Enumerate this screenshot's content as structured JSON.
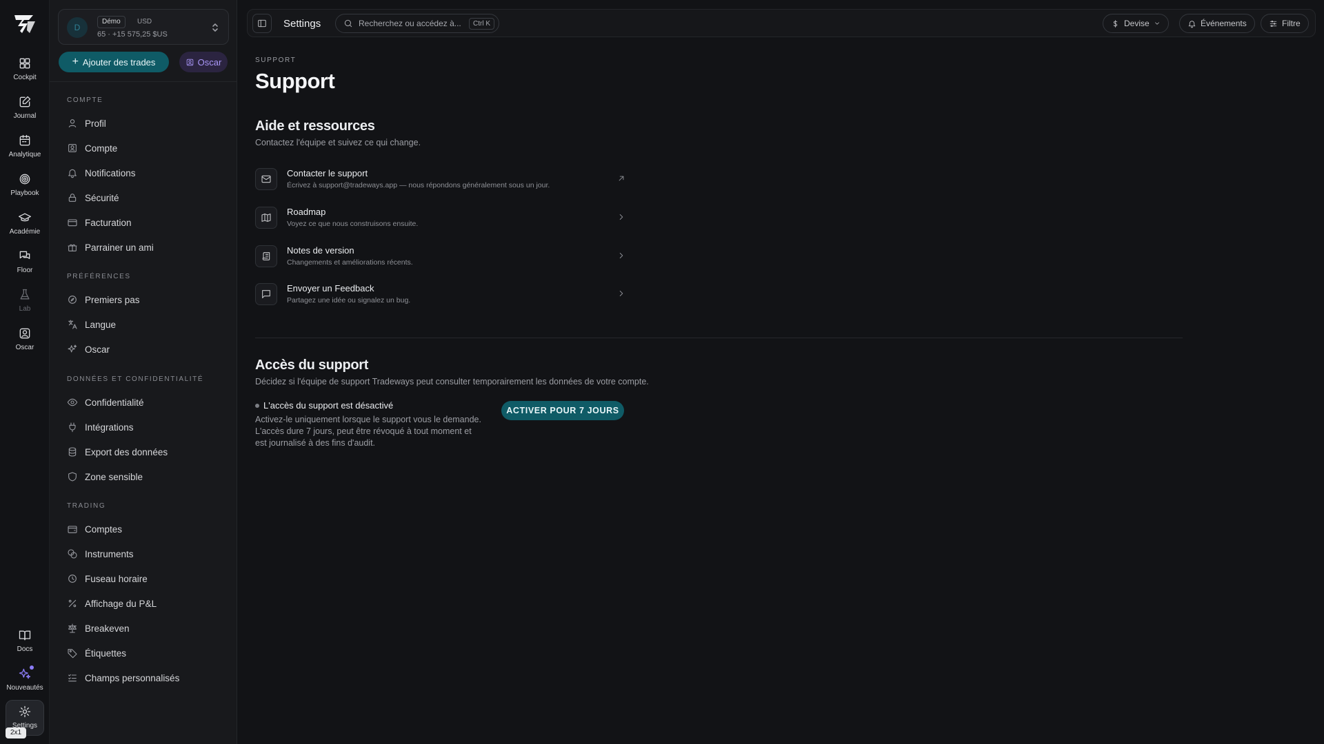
{
  "rail": {
    "items": [
      {
        "label": "Cockpit",
        "icon": "grid-icon"
      },
      {
        "label": "Journal",
        "icon": "edit-icon"
      },
      {
        "label": "Analytique",
        "icon": "calendar-icon"
      },
      {
        "label": "Playbook",
        "icon": "target-icon"
      },
      {
        "label": "Académie",
        "icon": "graduation-cap-icon"
      },
      {
        "label": "Floor",
        "icon": "chat-bubbles-icon"
      },
      {
        "label": "Lab",
        "icon": "flask-icon",
        "disabled": true
      },
      {
        "label": "Oscar",
        "icon": "bot-icon"
      }
    ],
    "bottom": [
      {
        "label": "Docs",
        "icon": "book-icon"
      },
      {
        "label": "Nouveautés",
        "icon": "sparkles-icon",
        "dot": true
      },
      {
        "label": "Settings",
        "icon": "gear-icon",
        "active": true
      }
    ],
    "zoom_badge": "2x1"
  },
  "account": {
    "avatar": "D",
    "mode": "Démo",
    "currency": "USD",
    "balance": "65 · +15 575,25 $US"
  },
  "actions": {
    "add_trades": "Ajouter des trades",
    "oscar": "Oscar"
  },
  "sidebar": {
    "sections": [
      {
        "title": "COMPTE",
        "items": [
          {
            "label": "Profil",
            "icon": "user-icon"
          },
          {
            "label": "Compte",
            "icon": "id-card-icon"
          },
          {
            "label": "Notifications",
            "icon": "bell-icon"
          },
          {
            "label": "Sécurité",
            "icon": "lock-icon"
          },
          {
            "label": "Facturation",
            "icon": "credit-card-icon"
          },
          {
            "label": "Parrainer un ami",
            "icon": "gift-icon"
          }
        ]
      },
      {
        "title": "PRÉFÉRENCES",
        "items": [
          {
            "label": "Premiers pas",
            "icon": "compass-icon"
          },
          {
            "label": "Langue",
            "icon": "translate-icon"
          },
          {
            "label": "Oscar",
            "icon": "sparkles-icon"
          }
        ]
      },
      {
        "title": "DONNÉES ET CONFIDENTIALITÉ",
        "items": [
          {
            "label": "Confidentialité",
            "icon": "eye-icon"
          },
          {
            "label": "Intégrations",
            "icon": "plug-icon"
          },
          {
            "label": "Export des données",
            "icon": "database-icon"
          },
          {
            "label": "Zone sensible",
            "icon": "shield-icon"
          }
        ]
      },
      {
        "title": "TRADING",
        "items": [
          {
            "label": "Comptes",
            "icon": "wallet-icon"
          },
          {
            "label": "Instruments",
            "icon": "coins-icon"
          },
          {
            "label": "Fuseau horaire",
            "icon": "clock-icon"
          },
          {
            "label": "Affichage du P&L",
            "icon": "percent-icon"
          },
          {
            "label": "Breakeven",
            "icon": "scale-icon"
          },
          {
            "label": "Étiquettes",
            "icon": "tag-icon"
          },
          {
            "label": "Champs personnalisés",
            "icon": "list-checks-icon"
          }
        ]
      }
    ]
  },
  "topbar": {
    "title": "Settings",
    "search_placeholder": "Recherchez ou accédez à...",
    "search_shortcut": "Ctrl K",
    "currency_label": "Devise",
    "events_label": "Événements",
    "filter_label": "Filtre"
  },
  "page": {
    "eyebrow": "SUPPORT",
    "title": "Support",
    "help": {
      "title": "Aide et ressources",
      "subtitle": "Contactez l'équipe et suivez ce qui change.",
      "items": [
        {
          "title": "Contacter le support",
          "desc": "Écrivez à support@tradeways.app — nous répondons généralement sous un jour.",
          "icon": "mail-icon",
          "arrow": "external-arrow-icon"
        },
        {
          "title": "Roadmap",
          "desc": "Voyez ce que nous construisons ensuite.",
          "icon": "map-icon",
          "arrow": "chevron-right-icon"
        },
        {
          "title": "Notes de version",
          "desc": "Changements et améliorations récents.",
          "icon": "scroll-icon",
          "arrow": "chevron-right-icon"
        },
        {
          "title": "Envoyer un Feedback",
          "desc": "Partagez une idée ou signalez un bug.",
          "icon": "message-square-icon",
          "arrow": "chevron-right-icon"
        }
      ]
    },
    "access": {
      "title": "Accès du support",
      "subtitle": "Décidez si l'équipe de support Tradeways peut consulter temporairement les données de votre compte.",
      "status": "L'accès du support est désactivé",
      "description": "Activez-le uniquement lorsque le support vous le demande. L'accès dure 7 jours, peut être révoqué à tout moment et est journalisé à des fins d'audit.",
      "button": "ACTIVER POUR 7 JOURS"
    }
  },
  "colors": {
    "background": "#121316",
    "sidebar": "#18191c",
    "accent_teal": "#0f5b66",
    "accent_purple": "#a996f7"
  }
}
